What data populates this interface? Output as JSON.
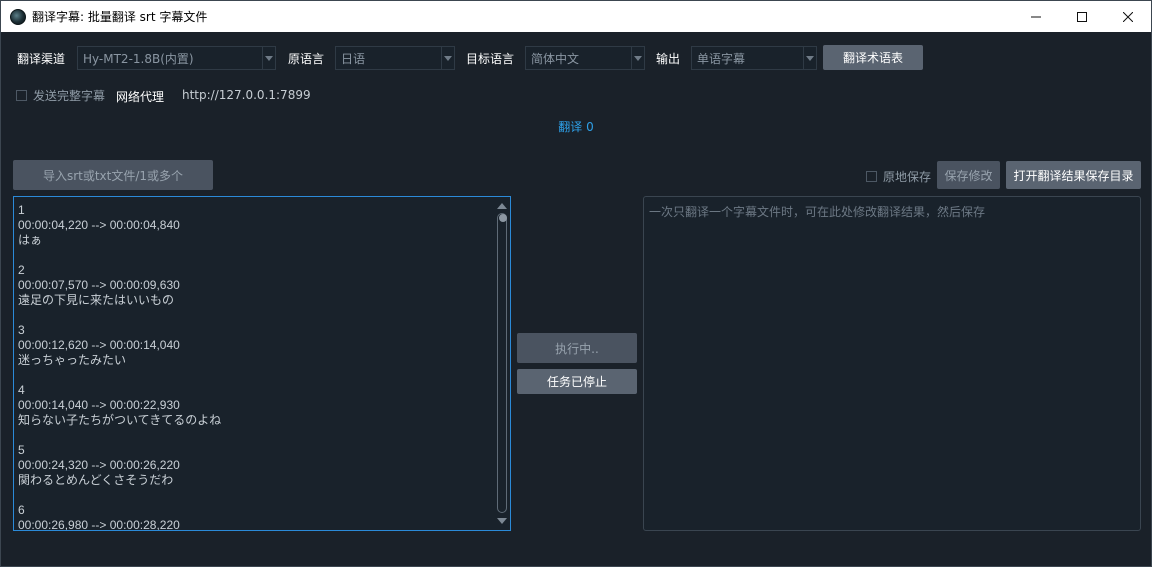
{
  "window": {
    "title": "翻译字幕: 批量翻译 srt 字幕文件",
    "controls": {
      "minimize": "minimize-icon",
      "maximize": "maximize-icon",
      "close": "close-icon"
    }
  },
  "toolbar": {
    "channel_label": "翻译渠道",
    "channel_value": "Hy-MT2-1.8B(内置)",
    "source_label": "原语言",
    "source_value": "日语",
    "target_label": "目标语言",
    "target_value": "简体中文",
    "output_label": "输出",
    "output_value": "单语字幕",
    "glossary_button": "翻译术语表"
  },
  "options": {
    "send_full_label": "发送完整字幕",
    "send_full_checked": false,
    "proxy_label": "网络代理",
    "proxy_value": "http://127.0.0.1:7899"
  },
  "status": {
    "text": "翻译 0"
  },
  "actions": {
    "import_button": "导入srt或txt文件/1或多个",
    "save_in_place_label": "原地保存",
    "save_in_place_checked": false,
    "save_changes_button": "保存修改",
    "open_dir_button": "打开翻译结果保存目录",
    "running_button": "执行中..",
    "stopped_button": "任务已停止"
  },
  "source_text": "1\n00:00:04,220 --> 00:00:04,840\nはぁ\n\n2\n00:00:07,570 --> 00:00:09,630\n遠足の下見に来たはいいもの\n\n3\n00:00:12,620 --> 00:00:14,040\n迷っちゃったみたい\n\n4\n00:00:14,040 --> 00:00:22,930\n知らない子たちがついてきてるのよね\n\n5\n00:00:24,320 --> 00:00:26,220\n関わるとめんどくさそうだわ\n\n6\n00:00:26,980 --> 00:00:28,220",
  "result_placeholder": "一次只翻译一个字幕文件时，可在此处修改翻译结果，然后保存",
  "colors": {
    "background": "#1a2129",
    "accent": "#2ea0e8",
    "button": "#4a5563"
  }
}
